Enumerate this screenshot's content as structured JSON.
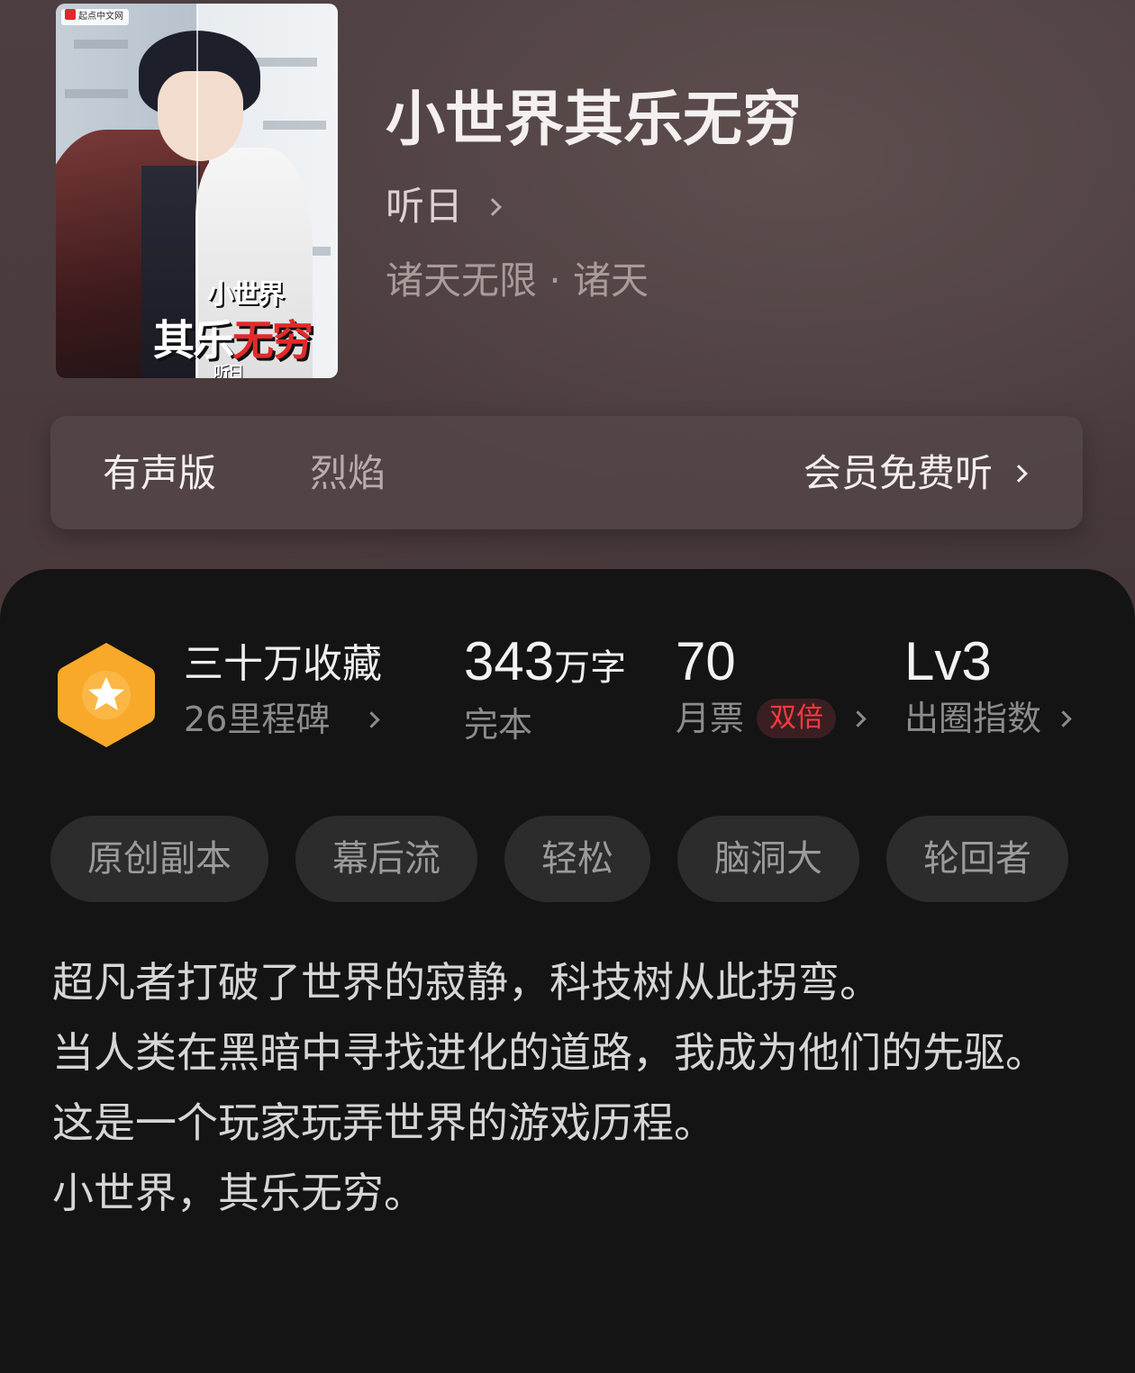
{
  "book": {
    "title": "小世界其乐无穷",
    "author": "听日",
    "genre": "诸天无限 · 诸天",
    "cover": {
      "badge": "起点中文网",
      "title_line1": "小世界",
      "title_line2_white": "其乐",
      "title_line2_red": "无穷",
      "author": "听日"
    }
  },
  "audio": {
    "label": "有声版",
    "voice": "烈焰",
    "cta": "会员免费听"
  },
  "stats": {
    "collect": {
      "title": "三十万收藏",
      "sub": "26里程碑"
    },
    "words": {
      "value": "343",
      "unit": "万字",
      "sub": "完本"
    },
    "ticket": {
      "value": "70",
      "sub": "月票",
      "badge": "双倍"
    },
    "level": {
      "value": "Lv3",
      "sub": "出圈指数"
    }
  },
  "tags": [
    "原创副本",
    "幕后流",
    "轻松",
    "脑洞大",
    "轮回者"
  ],
  "description": [
    "超凡者打破了世界的寂静，科技树从此拐弯。",
    "当人类在黑暗中寻找进化的道路，我成为他们的先驱。",
    "这是一个玩家玩弄世界的游戏历程。",
    "小世界，其乐无穷。"
  ],
  "colors": {
    "medal": "#f8a92a",
    "badge_red": "#ff3b3b",
    "panel_bg": "#141414"
  }
}
